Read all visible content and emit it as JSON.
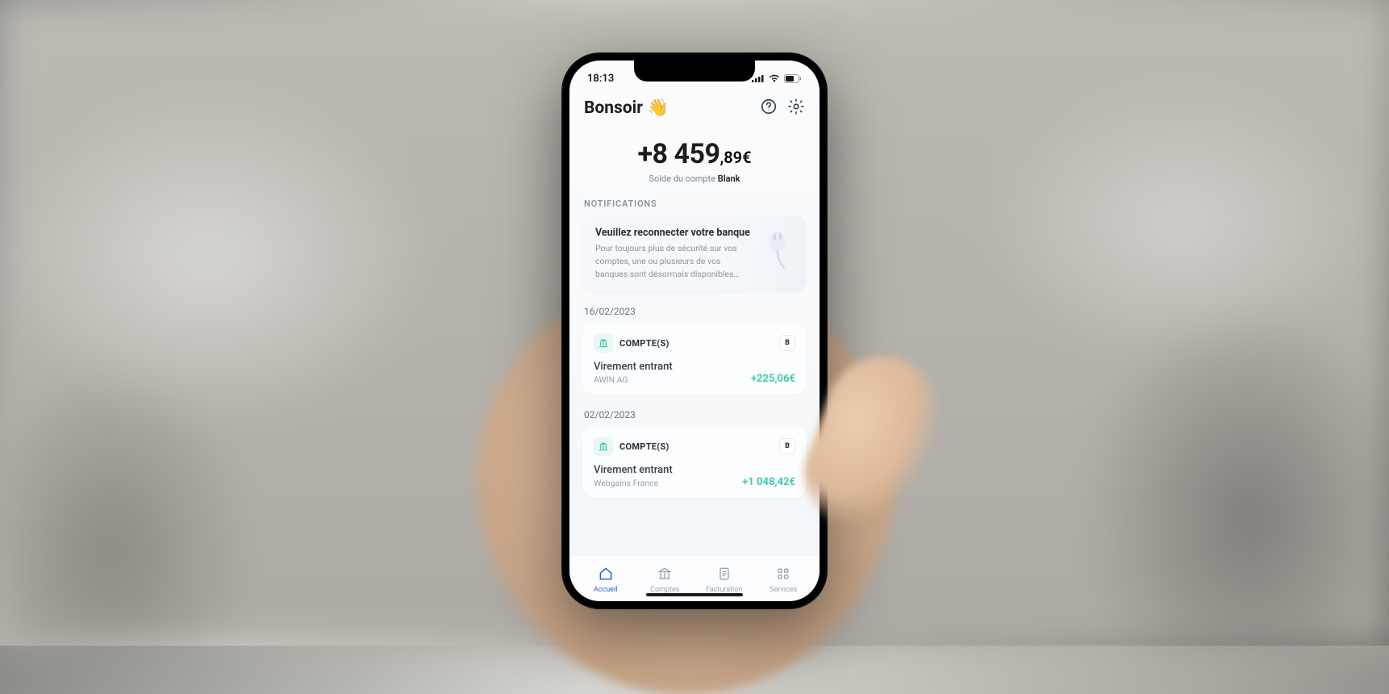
{
  "status": {
    "time": "18:13"
  },
  "header": {
    "greeting": "Bonsoir",
    "wave_emoji": "👋"
  },
  "balance": {
    "main": "+8 459",
    "cents": ",89€",
    "sub_prefix": "Solde du compte ",
    "sub_brand": "Blank"
  },
  "notifications": {
    "section_label": "NOTIFICATIONS",
    "card": {
      "title": "Veuillez reconnecter votre banque",
      "body": "Pour toujours plus de sécurité sur vos comptes, une ou plusieurs de vos  banques sont désormais disponibles…"
    }
  },
  "groups": [
    {
      "date": "16/02/2023",
      "account_label": "COMPTE(S)",
      "brand_chip": "B",
      "txn_title": "Virement entrant",
      "txn_sub": "AWIN AG",
      "amount": "+225,06€"
    },
    {
      "date": "02/02/2023",
      "account_label": "COMPTE(S)",
      "brand_chip": "B",
      "txn_title": "Virement entrant",
      "txn_sub": "Webgains France",
      "amount": "+1 048,42€"
    }
  ],
  "nav": {
    "items": [
      {
        "label": "Accueil"
      },
      {
        "label": "Comptes"
      },
      {
        "label": "Facturation"
      },
      {
        "label": "Services"
      }
    ]
  }
}
